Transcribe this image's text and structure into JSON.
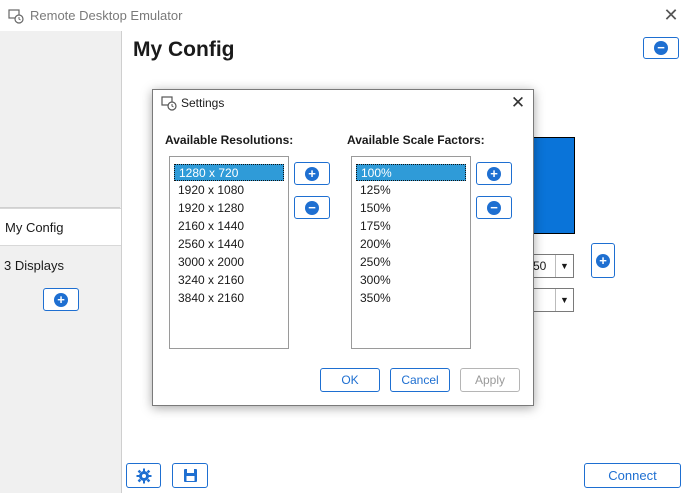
{
  "window": {
    "title": "Remote Desktop Emulator",
    "close_glyph": "✕"
  },
  "sidebar": {
    "selected_label": "My Config",
    "item_label": "3 Displays",
    "add_icon": "plus-icon"
  },
  "main": {
    "title": "My Config",
    "remove_icon": "minus-icon",
    "add_display_icon": "plus-icon",
    "combo1_value": "50",
    "combo2_value": "",
    "connect_label": "Connect",
    "settings_icon": "gear-icon",
    "save_icon": "save-icon",
    "accent": "#1e6fd1",
    "display_color": "#0a74d9"
  },
  "dialog": {
    "title": "Settings",
    "close_glyph": "✕",
    "resolutions_label": "Available Resolutions:",
    "scales_label": "Available Scale Factors:",
    "resolutions": [
      "1280 x 720",
      "1920 x 1080",
      "1920 x 1280",
      "2160 x 1440",
      "2560 x 1440",
      "3000 x 2000",
      "3240 x 2160",
      "3840 x 2160"
    ],
    "scales": [
      "100%",
      "125%",
      "150%",
      "175%",
      "200%",
      "250%",
      "300%",
      "350%"
    ],
    "selected_resolution": "1280 x 720",
    "selected_scale": "100%",
    "ok_label": "OK",
    "cancel_label": "Cancel",
    "apply_label": "Apply",
    "selection_color": "#2f9bd8"
  }
}
